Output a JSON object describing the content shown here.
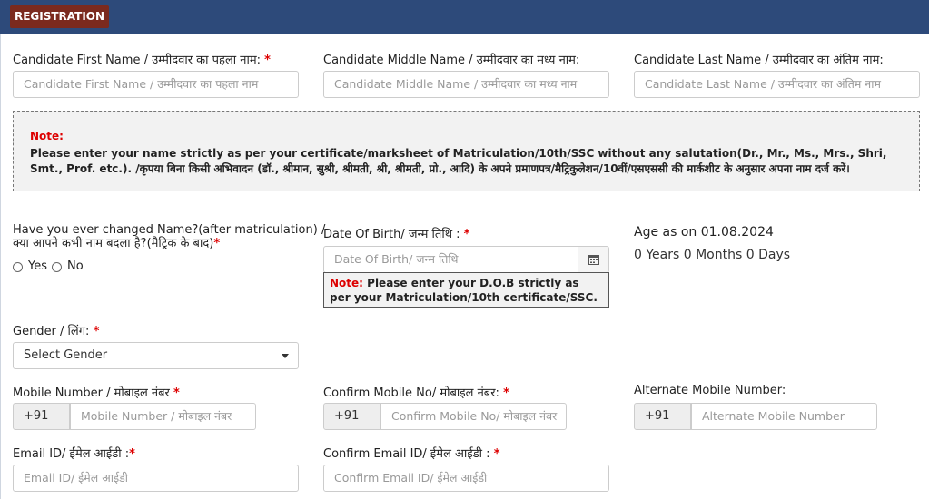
{
  "header": {
    "tab_label": "REGISTRATION"
  },
  "name": {
    "first_label": "Candidate First Name / उम्मीदवार का पहला नाम:",
    "first_placeholder": "Candidate First Name / उम्मीदवार का पहला नाम",
    "middle_label": "Candidate Middle Name / उम्मीदवार का मध्य नाम:",
    "middle_placeholder": "Candidate Middle Name / उम्मीदवार का मध्य नाम",
    "last_label": "Candidate Last Name / उम्मीदवार का अंतिम नाम:",
    "last_placeholder": "Candidate Last Name / उम्मीदवार का अंतिम नाम",
    "required_mark": "*"
  },
  "note": {
    "title": "Note:",
    "text": "Please enter your name strictly as per your certificate/marksheet of Matriculation/10th/SSC without any salutation(Dr., Mr., Ms., Mrs., Shri, Smt., Prof. etc.). /कृपया बिना किसी अभिवादन (डॉ., श्रीमान, सुश्री, श्रीमती, श्री, श्रीमती, प्रो., आदि) के अपने प्रमाणपत्र/मैट्रिकुलेशन/10वीं/एसएससी की मार्कशीट के अनुसार अपना नाम दर्ज करें।"
  },
  "name_change": {
    "label_line1": "Have you ever changed Name?(after matriculation) /",
    "label_line2": "क्या आपने कभी नाम बदला है?(मैट्रिक के बाद)",
    "yes": "Yes",
    "no": "No"
  },
  "dob": {
    "label": "Date Of Birth/ जन्म तिथि :",
    "placeholder": "Date Of Birth/ जन्म तिथि",
    "note_prefix": "Note:",
    "note_text": " Please enter your D.O.B strictly as per your Matriculation/10th certificate/SSC."
  },
  "age": {
    "title": "Age as on 01.08.2024",
    "value": "0 Years 0 Months 0 Days"
  },
  "gender": {
    "label": "Gender / लिंग:",
    "selected": "Select Gender"
  },
  "mobile": {
    "label": "Mobile Number / मोबाइल नंबर",
    "prefix": "+91",
    "placeholder": "Mobile Number / मोबाइल नंबर",
    "confirm_label": "Confirm Mobile No/ मोबाइल नंबर:",
    "confirm_placeholder": "Confirm Mobile No/ मोबाइल नंबर",
    "alt_label": "Alternate Mobile Number:",
    "alt_placeholder": "Alternate Mobile Number"
  },
  "email": {
    "label": "Email ID/ ईमेल आईडी :",
    "placeholder": "Email ID/ ईमेल आईडी",
    "confirm_label": "Confirm Email ID/ ईमेल आईडी :",
    "confirm_placeholder": "Confirm Email ID/ ईमेल आईडी"
  }
}
